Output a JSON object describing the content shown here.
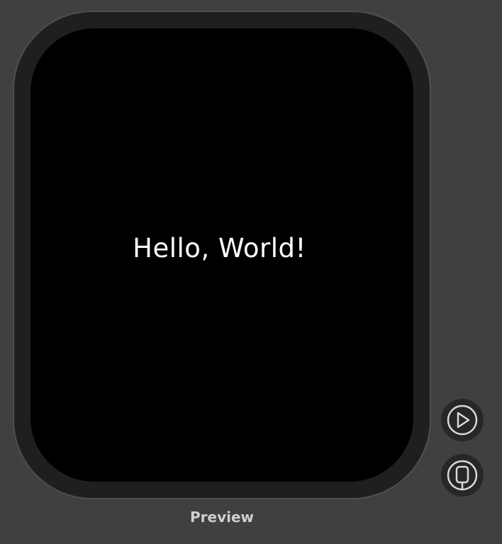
{
  "preview": {
    "screen_text": "Hello, World!",
    "label": "Preview"
  },
  "controls": {
    "live_preview_icon": "play-circle-icon",
    "device_settings_icon": "watch-device-icon"
  },
  "colors": {
    "background": "#404040",
    "frame": "#1f1f1f",
    "screen": "#000000",
    "text": "#ffffff",
    "button": "#272727",
    "icon_stroke": "#d8d8d8"
  }
}
